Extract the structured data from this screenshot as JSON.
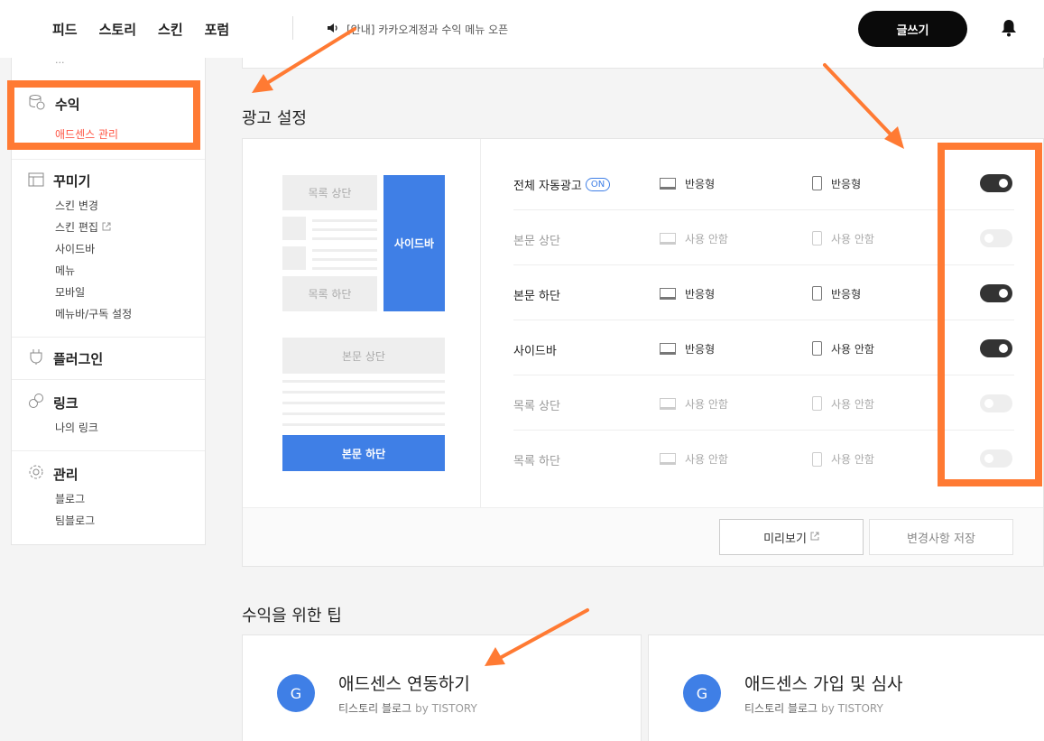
{
  "topbar": {
    "nav": [
      "피드",
      "스토리",
      "스킨",
      "포럼"
    ],
    "notice": "[안내] 카카오계정과 수익 메뉴 오픈",
    "write_label": "글쓰기"
  },
  "sidebar": {
    "cut_text": "...",
    "revenue": {
      "title": "수익",
      "sub": "애드센스 관리"
    },
    "decorate": {
      "title": "꾸미기",
      "items": [
        "스킨 변경",
        "스킨 편집",
        "사이드바",
        "메뉴",
        "모바일",
        "메뉴바/구독 설정"
      ]
    },
    "plugin": {
      "title": "플러그인"
    },
    "link": {
      "title": "링크",
      "items": [
        "나의 링크"
      ]
    },
    "manage": {
      "title": "관리",
      "items": [
        "블로그",
        "팀블로그"
      ]
    }
  },
  "ad_settings": {
    "title": "광고 설정",
    "preview": {
      "list_top": "목록 상단",
      "list_bottom": "목록 하단",
      "sidebar": "사이드바",
      "body_top": "본문 상단",
      "body_bottom": "본문 하단"
    },
    "rows": [
      {
        "label": "전체 자동광고",
        "badge": "ON",
        "pc": "반응형",
        "mobile": "반응형",
        "enabled": true
      },
      {
        "label": "본문 상단",
        "pc": "사용 안함",
        "mobile": "사용 안함",
        "enabled": false
      },
      {
        "label": "본문 하단",
        "pc": "반응형",
        "mobile": "반응형",
        "enabled": true
      },
      {
        "label": "사이드바",
        "pc": "반응형",
        "mobile": "사용 안함",
        "enabled": true
      },
      {
        "label": "목록 상단",
        "pc": "사용 안함",
        "mobile": "사용 안함",
        "enabled": false
      },
      {
        "label": "목록 하단",
        "pc": "사용 안함",
        "mobile": "사용 안함",
        "enabled": false
      }
    ],
    "preview_btn": "미리보기",
    "save_btn": "변경사항 저장"
  },
  "tips": {
    "title": "수익을 위한 팁",
    "cards": [
      {
        "logo": "G",
        "title": "애드센스 연동하기",
        "source": "티스토리 블로그",
        "by": "by TISTORY"
      },
      {
        "logo": "G",
        "title": "애드센스 가입 및 심사",
        "source": "티스토리 블로그",
        "by": "by TISTORY"
      }
    ]
  },
  "colors": {
    "accent": "#ff7a33",
    "blue": "#3f7fe6",
    "active_red": "#ff5544"
  }
}
